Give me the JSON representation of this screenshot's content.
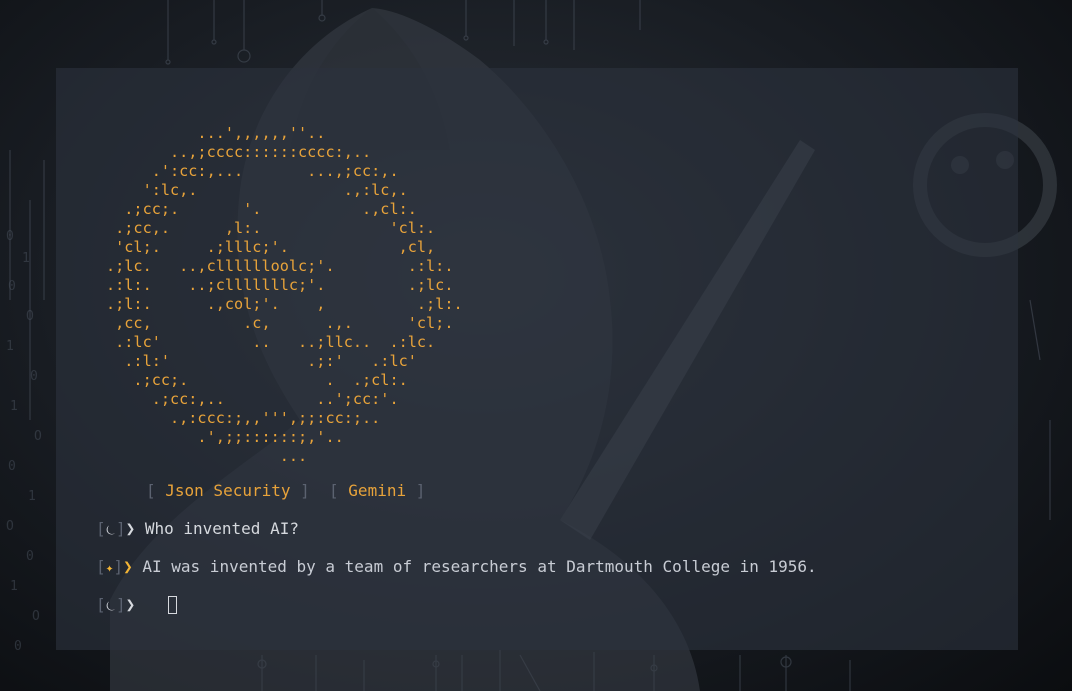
{
  "ascii_logo": [
    "          ...',,,,,,''..",
    "       ..,;cccc::::::cccc:,..",
    "     .':cc:,...       ...,;cc:,.",
    "    ':lc,.                .,:lc,.",
    "  .;cc;.       '.           .,cl:.",
    " .;cc,.      ,l:.              'cl:.",
    " 'cl;.     .;lllc;'.            ,cl,",
    ".;lc.   ..,clllllloolc;'.        .:l:.",
    ".:l:.    ..;clllllllc;'.         .;lc.",
    ".;l:.      .,col;'.    ,          .;l:.",
    " ,cc,          .c,      .,.      'cl;.",
    " .:lc'          ..   ..;llc..  .:lc.",
    "  .:l:'               .;:'   .:lc'",
    "   .;cc;.               .  .;cl:.",
    "     .;cc:,..          ..';cc:'.",
    "       .,:ccc:;,,''',;;:cc:;..",
    "          .',;;::::::;,'..",
    "                   ..."
  ],
  "header": {
    "left_label": "Json Security",
    "right_label": "Gemini"
  },
  "history": [
    {
      "role": "user",
      "icon": "user-icon",
      "text": "Who invented AI?"
    },
    {
      "role": "assistant",
      "icon": "sparkle-icon",
      "text": "AI was invented by a team of researchers at Dartmouth College in 1956."
    }
  ],
  "input": {
    "icon": "user-icon",
    "value": ""
  },
  "colors": {
    "accent": "#e8a33a",
    "text": "#d6d9de",
    "muted": "#5b6270",
    "terminal_bg": "#2c323e"
  }
}
